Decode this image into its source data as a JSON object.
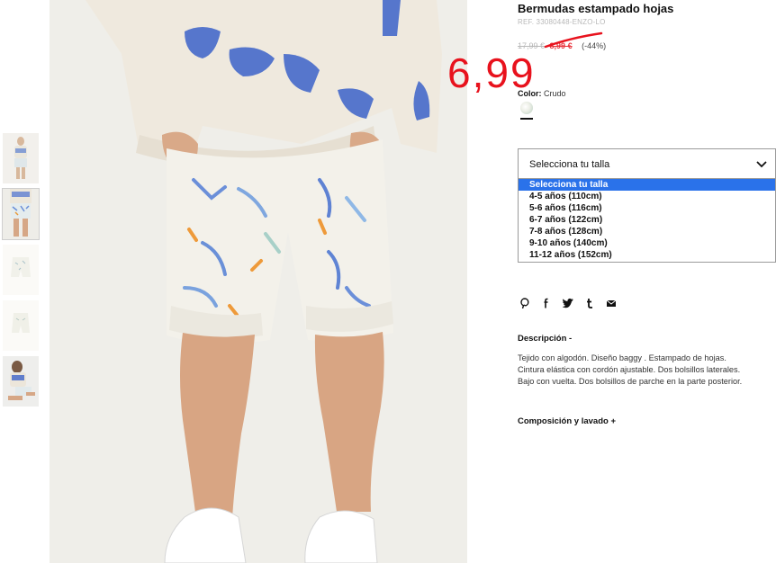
{
  "product": {
    "title": "Bermudas estampado hojas",
    "ref": "REF. 33080448-ENZO-LO",
    "old_price": "17,99 €",
    "current_price": "8,99 €",
    "discount": "(-44%)",
    "promo_price": "6,99",
    "color_label": "Color:",
    "color_value": "Crudo",
    "image_alt": "Bermudas estampado hojas"
  },
  "thumbnails": [
    {
      "name": "thumb-1",
      "active": false
    },
    {
      "name": "thumb-2",
      "active": true
    },
    {
      "name": "thumb-3",
      "active": false
    },
    {
      "name": "thumb-4",
      "active": false
    },
    {
      "name": "thumb-5",
      "active": false
    }
  ],
  "size_select": {
    "label": "Selecciona tu talla",
    "options": [
      "Selecciona tu talla",
      "4-5 años (110cm)",
      "5-6 años (116cm)",
      "6-7 años (122cm)",
      "7-8 años (128cm)",
      "9-10 años (140cm)",
      "11-12 años (152cm)"
    ],
    "highlighted_index": 0
  },
  "share_icons": [
    "pinterest-icon",
    "facebook-icon",
    "twitter-icon",
    "tumblr-icon",
    "email-icon"
  ],
  "description": {
    "title": "Descripción -",
    "lines": [
      "Tejido con algodón. Diseño baggy . Estampado de hojas.",
      "Cintura elástica con cordón ajustable. Dos bolsillos laterales.",
      "Bajo con vuelta. Dos bolsillos de parche en la parte posterior."
    ]
  },
  "composition": {
    "title": "Composición y lavado +"
  },
  "colors": {
    "sale_red": "#e8121d",
    "price_red": "#e8343c",
    "highlight_blue": "#2a72ea"
  }
}
